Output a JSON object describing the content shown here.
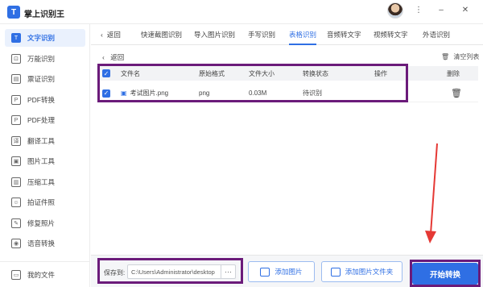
{
  "app": {
    "title": "掌上识别王",
    "logo_letter": "T"
  },
  "window": {
    "more": "⋮",
    "minimize": "–",
    "close": "✕"
  },
  "sidebar": {
    "items": [
      {
        "label": "文字识别",
        "icon": "T",
        "active": true
      },
      {
        "label": "万能识别",
        "icon": "⊡"
      },
      {
        "label": "票证识别",
        "icon": "▤"
      },
      {
        "label": "PDF转换",
        "icon": "P"
      },
      {
        "label": "PDF处理",
        "icon": "P"
      },
      {
        "label": "翻译工具",
        "icon": "译"
      },
      {
        "label": "图片工具",
        "icon": "▣"
      },
      {
        "label": "压缩工具",
        "icon": "▥"
      },
      {
        "label": "拍证件照",
        "icon": "☺"
      },
      {
        "label": "修复照片",
        "icon": "✎"
      },
      {
        "label": "语音转换",
        "icon": "◉"
      }
    ],
    "footer": {
      "label": "我的文件",
      "icon": "▭"
    }
  },
  "tabs": {
    "back": "返回",
    "items": [
      "快速截图识别",
      "导入图片识别",
      "手写识别",
      "表格识别",
      "音频转文字",
      "视频转文字",
      "外语识别"
    ],
    "active_index": 3
  },
  "content": {
    "back": "返回",
    "clear_list": "清空列表",
    "table": {
      "headers": [
        "文件名",
        "原始格式",
        "文件大小",
        "转换状态",
        "操作",
        "删除"
      ],
      "rows": [
        {
          "checked": true,
          "filename": "考试图片.png",
          "format": "png",
          "size": "0.03M",
          "status": "待识别"
        }
      ]
    }
  },
  "bottom": {
    "save_label": "保存到:",
    "save_path": "C:\\Users\\Administrator\\desktop",
    "more": "···",
    "add_image": "添加图片",
    "add_folder": "添加图片文件夹",
    "start": "开始转换"
  },
  "colors": {
    "accent": "#2f6fe4",
    "highlight": "#6b1b7a",
    "arrow": "#e53935"
  }
}
